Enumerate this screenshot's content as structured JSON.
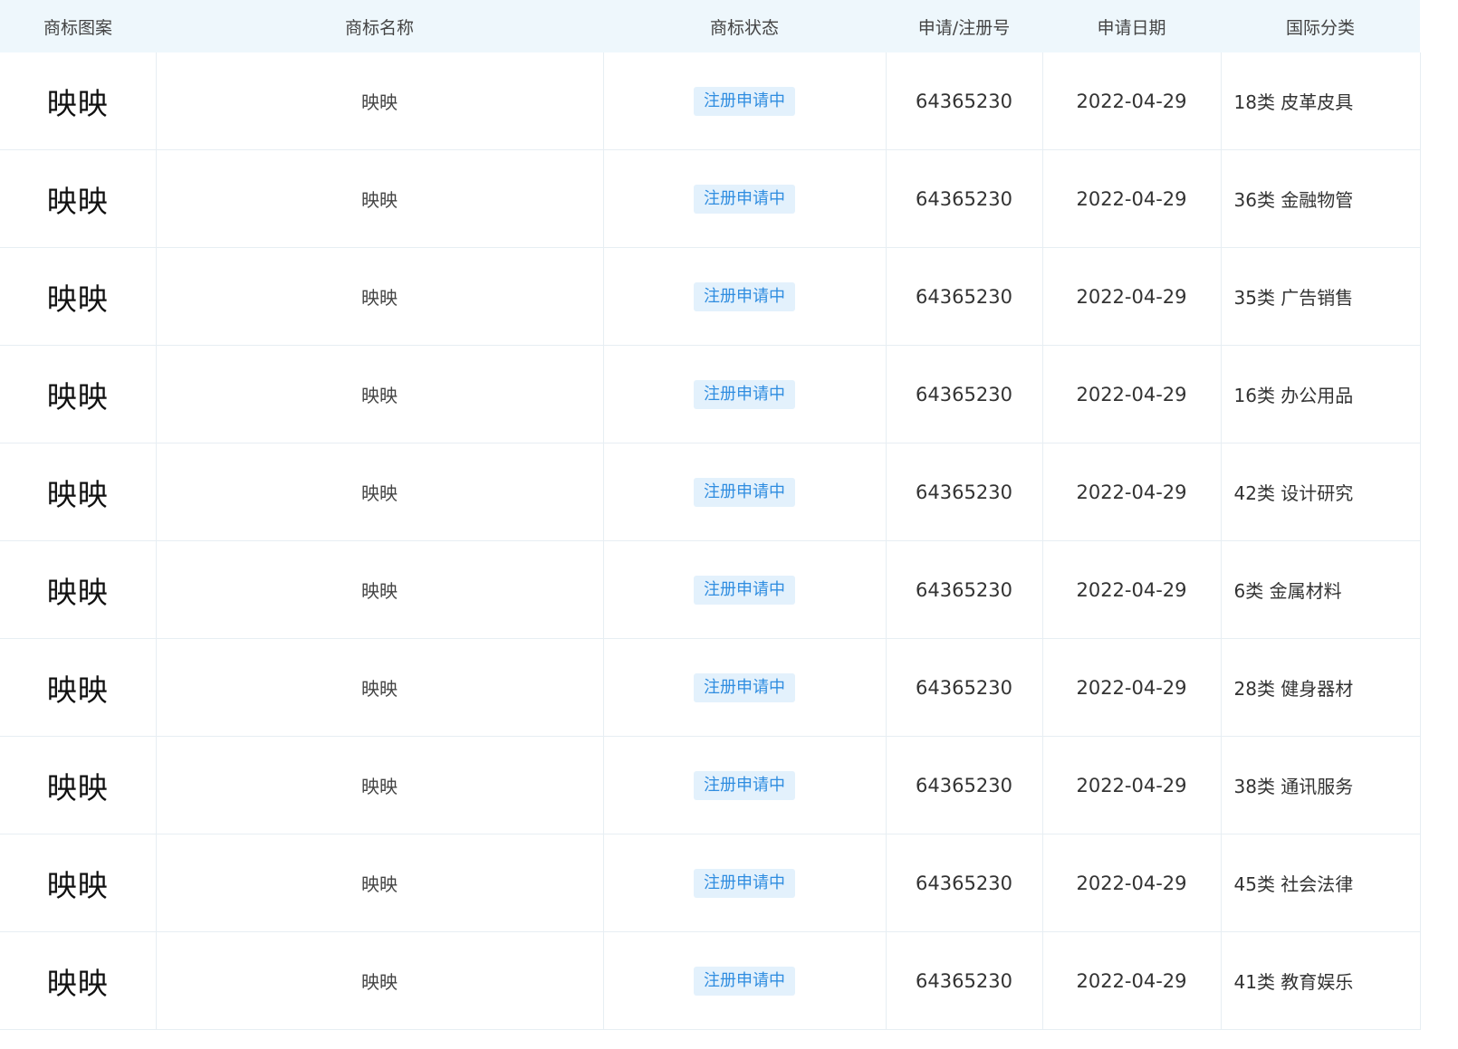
{
  "table": {
    "headers": [
      "商标图案",
      "商标名称",
      "商标状态",
      "申请/注册号",
      "申请日期",
      "国际分类"
    ],
    "rows": [
      {
        "logo": "映映",
        "name": "映映",
        "status": "注册申请中",
        "reg_no": "64365230",
        "date": "2022-04-29",
        "class": "18类 皮革皮具"
      },
      {
        "logo": "映映",
        "name": "映映",
        "status": "注册申请中",
        "reg_no": "64365230",
        "date": "2022-04-29",
        "class": "36类 金融物管"
      },
      {
        "logo": "映映",
        "name": "映映",
        "status": "注册申请中",
        "reg_no": "64365230",
        "date": "2022-04-29",
        "class": "35类 广告销售"
      },
      {
        "logo": "映映",
        "name": "映映",
        "status": "注册申请中",
        "reg_no": "64365230",
        "date": "2022-04-29",
        "class": "16类 办公用品"
      },
      {
        "logo": "映映",
        "name": "映映",
        "status": "注册申请中",
        "reg_no": "64365230",
        "date": "2022-04-29",
        "class": "42类 设计研究"
      },
      {
        "logo": "映映",
        "name": "映映",
        "status": "注册申请中",
        "reg_no": "64365230",
        "date": "2022-04-29",
        "class": "6类 金属材料"
      },
      {
        "logo": "映映",
        "name": "映映",
        "status": "注册申请中",
        "reg_no": "64365230",
        "date": "2022-04-29",
        "class": "28类 健身器材"
      },
      {
        "logo": "映映",
        "name": "映映",
        "status": "注册申请中",
        "reg_no": "64365230",
        "date": "2022-04-29",
        "class": "38类 通讯服务"
      },
      {
        "logo": "映映",
        "name": "映映",
        "status": "注册申请中",
        "reg_no": "64365230",
        "date": "2022-04-29",
        "class": "45类 社会法律"
      },
      {
        "logo": "映映",
        "name": "映映",
        "status": "注册申请中",
        "reg_no": "64365230",
        "date": "2022-04-29",
        "class": "41类 教育娱乐"
      }
    ]
  },
  "colors": {
    "header_bg": "#eef7fc",
    "status_bg": "#e3f1fc",
    "status_text": "#2f8de0",
    "grid_line": "#e7eef3"
  }
}
